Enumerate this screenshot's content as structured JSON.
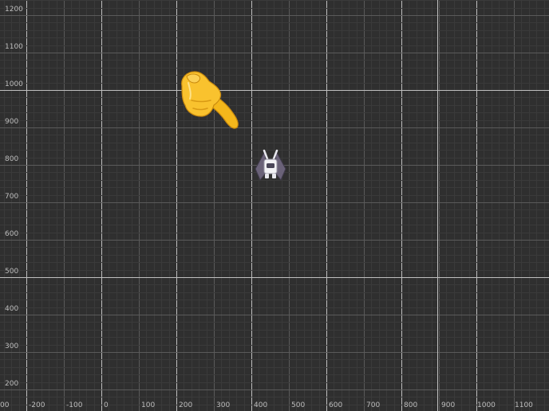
{
  "editor": {
    "y_axis_labels": [
      "1200",
      "1100",
      "1000",
      "900",
      "800",
      "700",
      "600",
      "500",
      "400",
      "300",
      "200"
    ],
    "x_axis_labels": [
      "00",
      "-200",
      "-100",
      "0",
      "100",
      "200",
      "300",
      "400",
      "500",
      "600",
      "700",
      "800",
      "900",
      "1000",
      "1100"
    ],
    "colors": {
      "background": "#2f2f2f",
      "grid_minor": "#3a3a3a",
      "grid_major": "#5a5a5a",
      "axis": "#bfbfbf",
      "label": "#bdbdbd"
    }
  },
  "sprites": {
    "pointer": {
      "icon": "pointing-hand-icon"
    },
    "ship": {
      "icon": "spaceship-sprite"
    }
  }
}
